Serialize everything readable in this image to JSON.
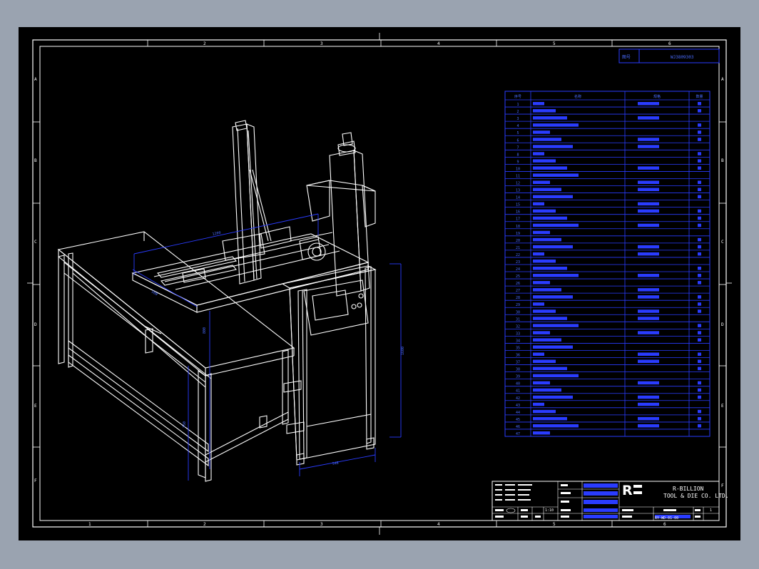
{
  "colors": {
    "background": "#9aa3b0",
    "canvas": "#000000",
    "frame": "#ffffff",
    "blue": "#2a3cff",
    "text_blue": "#4a6cff"
  },
  "zone_top": [
    "2",
    "3",
    "4",
    "5",
    "6"
  ],
  "zone_bottom": [
    "1",
    "2",
    "3",
    "4",
    "5",
    "6"
  ],
  "zone_left": [
    "A",
    "B",
    "C",
    "D",
    "E",
    "F"
  ],
  "zone_right": [
    "A",
    "B",
    "C",
    "D",
    "E",
    "F"
  ],
  "drawing_no": {
    "label": "图号",
    "value": "WJ3809303"
  },
  "bom": {
    "headers": [
      "序号",
      "名称",
      "规格",
      "数量"
    ],
    "rows": [
      [
        "1",
        "",
        "",
        ""
      ],
      [
        "2",
        "",
        "",
        ""
      ],
      [
        "3",
        "",
        "",
        ""
      ],
      [
        "4",
        "",
        "",
        ""
      ],
      [
        "5",
        "",
        "",
        ""
      ],
      [
        "6",
        "",
        "",
        ""
      ],
      [
        "7",
        "",
        "",
        ""
      ],
      [
        "8",
        "",
        "",
        ""
      ],
      [
        "9",
        "",
        "",
        ""
      ],
      [
        "10",
        "",
        "",
        ""
      ],
      [
        "11",
        "",
        "",
        ""
      ],
      [
        "12",
        "",
        "",
        ""
      ],
      [
        "13",
        "",
        "",
        ""
      ],
      [
        "14",
        "",
        "",
        ""
      ],
      [
        "15",
        "",
        "",
        ""
      ],
      [
        "16",
        "",
        "",
        ""
      ],
      [
        "17",
        "",
        "",
        ""
      ],
      [
        "18",
        "",
        "",
        ""
      ],
      [
        "19",
        "",
        "",
        ""
      ],
      [
        "20",
        "",
        "",
        ""
      ],
      [
        "21",
        "",
        "",
        ""
      ],
      [
        "22",
        "",
        "",
        ""
      ],
      [
        "23",
        "",
        "",
        ""
      ],
      [
        "24",
        "",
        "",
        ""
      ],
      [
        "25",
        "",
        "",
        ""
      ],
      [
        "26",
        "",
        "",
        ""
      ],
      [
        "27",
        "",
        "",
        ""
      ],
      [
        "28",
        "",
        "",
        ""
      ],
      [
        "29",
        "",
        "",
        ""
      ],
      [
        "30",
        "",
        "",
        ""
      ],
      [
        "31",
        "",
        "",
        ""
      ],
      [
        "32",
        "",
        "",
        ""
      ],
      [
        "33",
        "",
        "",
        ""
      ],
      [
        "34",
        "",
        "",
        ""
      ],
      [
        "35",
        "",
        "",
        ""
      ],
      [
        "36",
        "",
        "",
        ""
      ],
      [
        "37",
        "",
        "",
        ""
      ],
      [
        "38",
        "",
        "",
        ""
      ],
      [
        "39",
        "",
        "",
        ""
      ],
      [
        "40",
        "",
        "",
        ""
      ],
      [
        "41",
        "",
        "",
        ""
      ],
      [
        "42",
        "",
        "",
        ""
      ],
      [
        "43",
        "",
        "",
        ""
      ],
      [
        "44",
        "",
        "",
        ""
      ],
      [
        "45",
        "",
        "",
        ""
      ],
      [
        "46",
        "",
        "",
        ""
      ],
      [
        "47",
        "",
        "",
        ""
      ]
    ]
  },
  "dimensions": {
    "top_width": "1200",
    "left_depth": "580",
    "table_height": "800",
    "total_height": "1600",
    "bottom_width": "548",
    "left_height": "750"
  },
  "title_block": {
    "company_line1": "R-BILLION",
    "company_line2": "TOOL & DIE CO. LTD.",
    "logo_letter": "R",
    "scale": "1:10",
    "drawing_code": "RY-WD-01-00",
    "sheet": "1"
  }
}
